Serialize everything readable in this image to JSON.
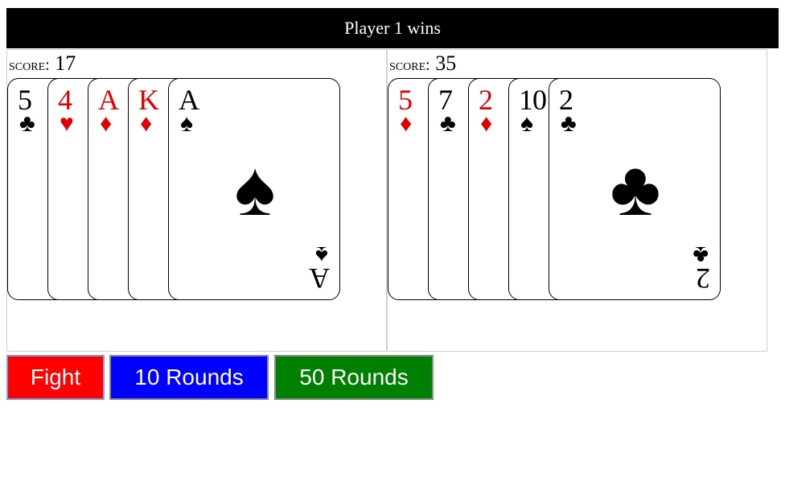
{
  "banner": {
    "text": "Player 1 wins"
  },
  "players": [
    {
      "score_label": "SCORE:",
      "score": "17",
      "cards": [
        {
          "rank": "5",
          "suit": "♣",
          "color": "black"
        },
        {
          "rank": "4",
          "suit": "♥",
          "color": "red"
        },
        {
          "rank": "A",
          "suit": "♦",
          "color": "red"
        },
        {
          "rank": "K",
          "suit": "♦",
          "color": "red"
        },
        {
          "rank": "A",
          "suit": "♠",
          "color": "black"
        }
      ]
    },
    {
      "score_label": "SCORE:",
      "score": "35",
      "cards": [
        {
          "rank": "5",
          "suit": "♦",
          "color": "red"
        },
        {
          "rank": "7",
          "suit": "♣",
          "color": "black"
        },
        {
          "rank": "2",
          "suit": "♦",
          "color": "red"
        },
        {
          "rank": "10",
          "suit": "♠",
          "color": "black"
        },
        {
          "rank": "2",
          "suit": "♣",
          "color": "black"
        }
      ]
    }
  ],
  "buttons": {
    "fight": "Fight",
    "ten_rounds": "10 Rounds",
    "fifty_rounds": "50 Rounds"
  },
  "colors": {
    "fight": "#ff0000",
    "ten_rounds": "#0000ff",
    "fifty_rounds": "#008000",
    "red_suit": "#e00000",
    "black_suit": "#000000"
  }
}
